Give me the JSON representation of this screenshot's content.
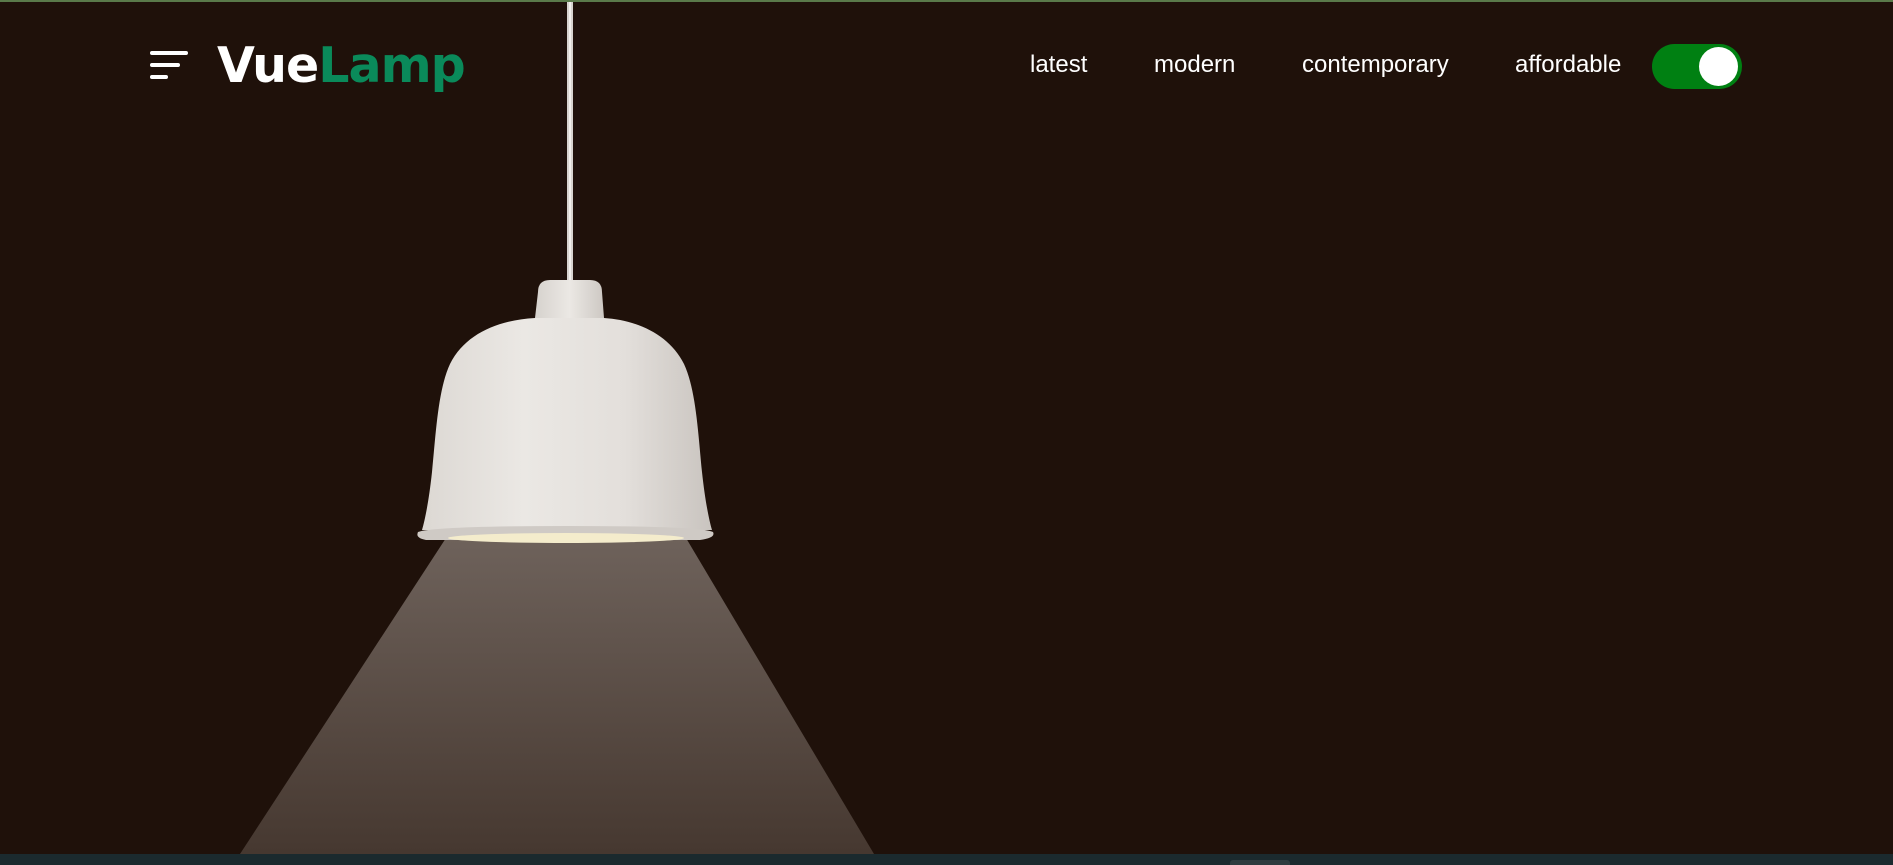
{
  "header": {
    "menu_icon": "hamburger-menu-icon",
    "logo": {
      "part1": "Vue",
      "part2": "Lamp",
      "part2_color": "#0a8a5a"
    },
    "nav": [
      {
        "label": "latest"
      },
      {
        "label": "modern"
      },
      {
        "label": "contemporary"
      },
      {
        "label": "affordable"
      }
    ],
    "theme_toggle": {
      "state": "on",
      "color": "#008012"
    }
  },
  "hero": {
    "background_color": "#1f110a",
    "lamp_color": "#e6e3df",
    "light_beam": "on"
  }
}
